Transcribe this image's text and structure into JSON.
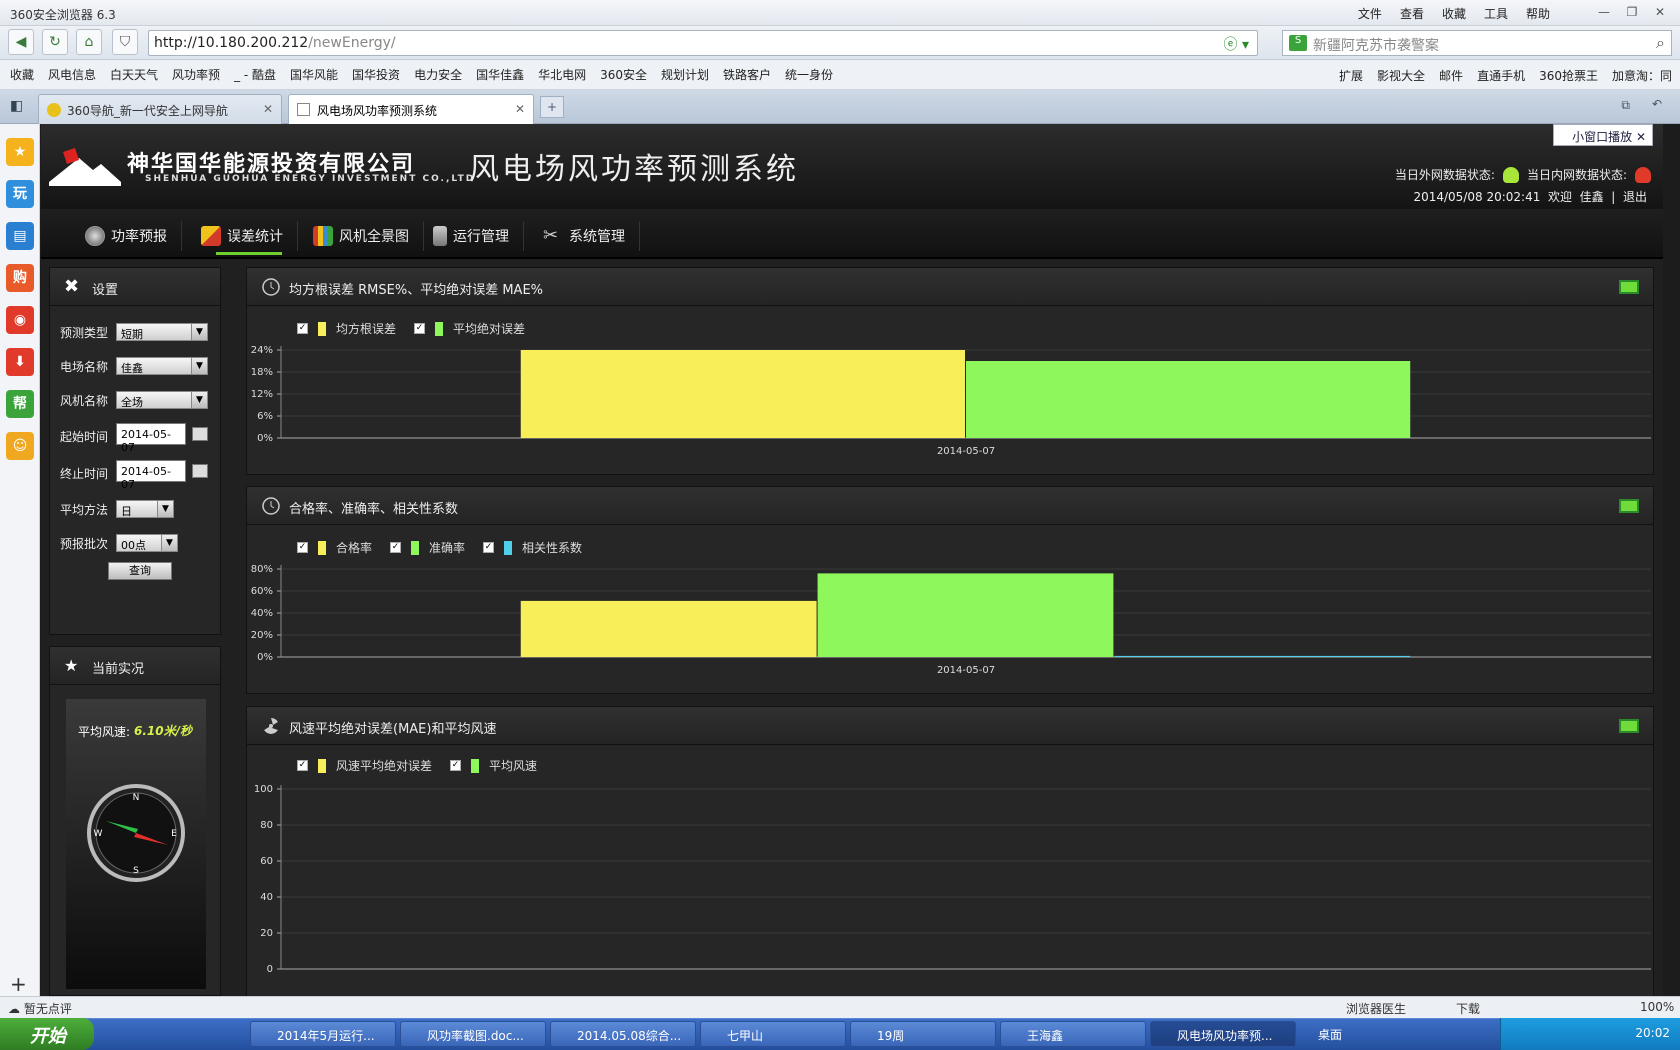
{
  "browser": {
    "title": "360安全浏览器 6.3",
    "menu": [
      "文件",
      "查看",
      "收藏",
      "工具",
      "帮助"
    ],
    "url_host": "http://10.180.200.212",
    "url_path": "/newEnergy/",
    "search_placeholder": "新疆阿克苏市袭警案",
    "bookmarks": [
      "收藏",
      "风电信息",
      "白天天气",
      "风功率预",
      "_ - 酷盘",
      "国华风能",
      "国华投资",
      "电力安全",
      "国华佳鑫",
      "华北电网",
      "360安全",
      "规划计划",
      "铁路客户",
      "统一身份"
    ],
    "bookmarks_right": [
      "扩展",
      "影视大全",
      "邮件",
      "直通手机",
      "360抢票王",
      "加意淘：同"
    ],
    "tabs": [
      {
        "label": "360导航_新一代安全上网导航",
        "active": false
      },
      {
        "label": "风电场风功率预测系统",
        "active": true
      }
    ],
    "mini_window": "小窗口播放",
    "status_left": "暂无点评",
    "status_right": [
      "浏览器医生",
      "下载",
      "100%"
    ]
  },
  "header": {
    "company_cn": "神华国华能源投资有限公司",
    "company_en": "SHENHUA GUOHUA ENERGY INVESTMENT CO.,LTD",
    "system_title": "风电场风功率预测系统",
    "ext_status_label": "当日外网数据状态:",
    "int_status_label": "当日内网数据状态:",
    "datetime": "2014/05/08 20:02:41",
    "welcome": "欢迎",
    "user": "佳鑫",
    "sep": "|",
    "logout": "退出",
    "colors": {
      "ext_status": "#a8e63a",
      "int_status": "#e03a2a"
    }
  },
  "nav": [
    {
      "label": "功率预报",
      "icon": "gauge-icon"
    },
    {
      "label": "误差统计",
      "icon": "cube-icon",
      "active": true
    },
    {
      "label": "风机全景图",
      "icon": "books-icon"
    },
    {
      "label": "运行管理",
      "icon": "trash-icon"
    },
    {
      "label": "系统管理",
      "icon": "tools-icon"
    }
  ],
  "settings": {
    "title": "设置",
    "fields": {
      "forecast_type": {
        "label": "预测类型",
        "value": "短期"
      },
      "farm_name": {
        "label": "电场名称",
        "value": "佳鑫"
      },
      "turbine_name": {
        "label": "风机名称",
        "value": "全场"
      },
      "start_time": {
        "label": "起始时间",
        "value": "2014-05-07"
      },
      "end_time": {
        "label": "终止时间",
        "value": "2014-05-07"
      },
      "avg_method": {
        "label": "平均方法",
        "value": "日"
      },
      "batch": {
        "label": "预报批次",
        "value": "00点"
      }
    },
    "query_button": "查询"
  },
  "current": {
    "title": "当前实况",
    "wind_label": "平均风速:",
    "wind_value": "6.10米/秒",
    "compass": {
      "n": "N",
      "e": "E",
      "s": "S",
      "w": "W"
    }
  },
  "chart_data": [
    {
      "type": "bar",
      "title": "均方根误差 RMSE%、平均绝对误差 MAE%",
      "categories": [
        "2014-05-07"
      ],
      "yticks": [
        "0%",
        "6%",
        "12%",
        "18%",
        "24%"
      ],
      "ylim": [
        0,
        24
      ],
      "grid": true,
      "legend_placement": "top-left",
      "series": [
        {
          "name": "均方根误差",
          "values": [
            24
          ],
          "color": "#f8ee5a"
        },
        {
          "name": "平均绝对误差",
          "values": [
            21
          ],
          "color": "#8ef75c"
        }
      ]
    },
    {
      "type": "bar",
      "title": "合格率、准确率、相关性系数",
      "categories": [
        "2014-05-07"
      ],
      "yticks": [
        "0%",
        "20%",
        "40%",
        "60%",
        "80%"
      ],
      "ylim": [
        0,
        80
      ],
      "grid": true,
      "legend_placement": "top-left",
      "series": [
        {
          "name": "合格率",
          "values": [
            51
          ],
          "color": "#f8ee5a"
        },
        {
          "name": "准确率",
          "values": [
            76
          ],
          "color": "#8ef75c"
        },
        {
          "name": "相关性系数",
          "values": [
            1
          ],
          "color": "#4fd0e8"
        }
      ]
    },
    {
      "type": "bar",
      "title": "风速平均绝对误差(MAE)和平均风速",
      "categories": [],
      "yticks": [
        "0",
        "20",
        "40",
        "60",
        "80",
        "100"
      ],
      "ylim": [
        0,
        100
      ],
      "grid": true,
      "legend_placement": "top-left",
      "series": [
        {
          "name": "风速平均绝对误差",
          "values": [],
          "color": "#f8ee5a"
        },
        {
          "name": "平均风速",
          "values": [],
          "color": "#8ef75c"
        }
      ]
    }
  ],
  "taskbar": {
    "start": "开始",
    "tasks": [
      "2014年5月运行...",
      "风功率截图.doc...",
      "2014.05.08综合...",
      "七甲山",
      "19周",
      "王海鑫",
      "风电场风功率预..."
    ],
    "desktop": "桌面",
    "clock": "20:02"
  }
}
